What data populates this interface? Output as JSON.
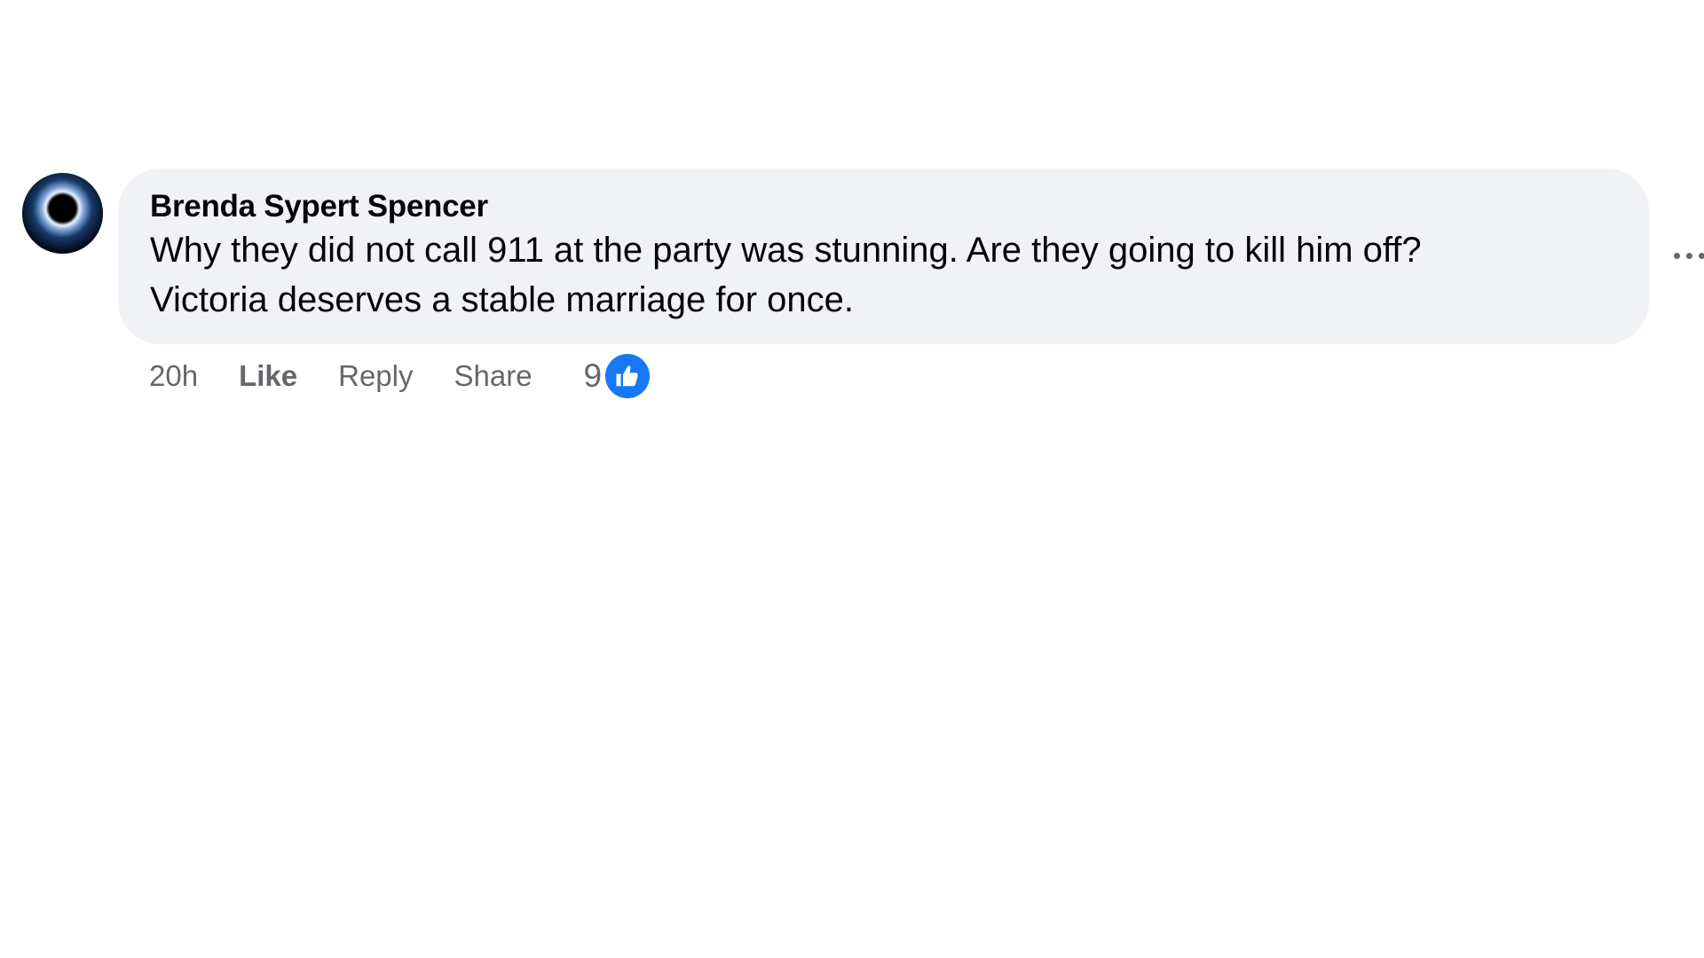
{
  "comment": {
    "author": "Brenda Sypert Spencer",
    "text_lines": [
      "Why they did not call 911 at the party was stunning. Are they going to kill him off?",
      "Victoria deserves a stable marriage for once."
    ],
    "timestamp": "20h",
    "actions": {
      "like": "Like",
      "reply": "Reply",
      "share": "Share"
    },
    "reaction_count": "9",
    "reaction_icon": "thumbs-up-icon",
    "avatar_icon": "avatar",
    "more_icon": "more-options-icon"
  },
  "colors": {
    "bubble_bg": "#f0f2f5",
    "secondary_text": "#65676b",
    "like_blue": "#1877f2"
  }
}
